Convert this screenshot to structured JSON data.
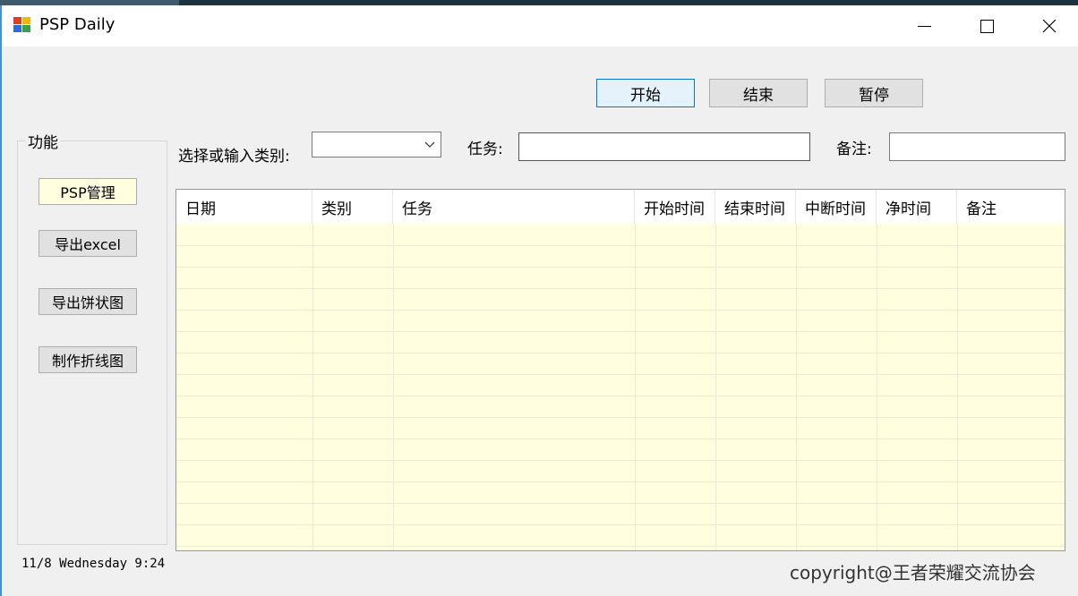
{
  "window": {
    "title": "PSP Daily"
  },
  "toolbar": {
    "start_label": "开始",
    "end_label": "结束",
    "pause_label": "暂停"
  },
  "sidebar": {
    "group_title": "功能",
    "items": [
      {
        "label": "PSP管理"
      },
      {
        "label": "导出excel"
      },
      {
        "label": "导出饼状图"
      },
      {
        "label": "制作折线图"
      }
    ]
  },
  "form": {
    "category_label": "选择或输入类别:",
    "category_value": "",
    "task_label": "任务:",
    "task_value": "",
    "note_label": "备注:",
    "note_value": ""
  },
  "table": {
    "columns": [
      "日期",
      "类别",
      "任务",
      "开始时间",
      "结束时间",
      "中断时间",
      "净时间",
      "备注"
    ],
    "rows": []
  },
  "status": {
    "datetime": "11/8  Wednesday 9:24"
  },
  "footer": {
    "copyright": "copyright@王者荣耀交流协会"
  },
  "colors": {
    "grid_background": "#ffffe0",
    "accent": "#0078d7",
    "window_border": "#3a96d6"
  }
}
